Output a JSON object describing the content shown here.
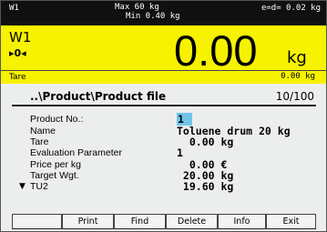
{
  "status_bar": {
    "scale_name": "W1",
    "max_capacity": "Max 60 kg",
    "min_capacity": "Min 0.40 kg",
    "division": "e=d= 0.02 kg"
  },
  "weight_display": {
    "scale_name": "W1",
    "zero_indicator": "▸0◂",
    "weight_value": "0.00",
    "unit": "kg",
    "tare_label": "Tare",
    "tare_value": "0.00 kg",
    "display_color": "#f7f200"
  },
  "product_file": {
    "title": "..\\Product\\Product file",
    "record_counter": "10/100",
    "fields": [
      {
        "label": "Product No.:",
        "value": "1"
      },
      {
        "label": "Name",
        "value": "Toluene drum 20 kg"
      },
      {
        "label": "Tare",
        "value": "  0.00 kg"
      },
      {
        "label": "Evaluation Parameter",
        "value": "1"
      },
      {
        "label": "Price per kg",
        "value": "  0.00 €"
      },
      {
        "label": "Target Wgt.",
        "value": " 20.00 kg"
      },
      {
        "label": "TU2",
        "value": " 19.60 kg"
      }
    ],
    "selection_color": "#6fc5e8"
  },
  "softkeys": [
    "",
    "Print",
    "Find",
    "Delete",
    "Info",
    "Exit"
  ]
}
